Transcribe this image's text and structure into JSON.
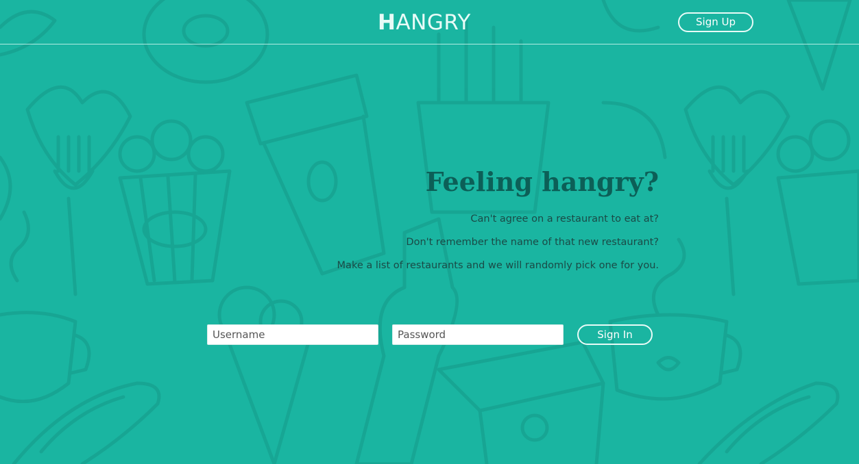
{
  "header": {
    "logo_first": "H",
    "logo_rest": "ANGRY",
    "signup_label": "Sign Up"
  },
  "hero": {
    "title": "Feeling hangry?",
    "lines": [
      "Can't agree on a restaurant to eat at?",
      "Don't remember the name of that new restaurant?",
      "Make a list of restaurants and we will randomly pick one for you."
    ]
  },
  "login": {
    "username_placeholder": "Username",
    "password_placeholder": "Password",
    "signin_label": "Sign In"
  },
  "colors": {
    "background": "#1ab5a1",
    "title": "#0c5f57",
    "text": "#1a4a46",
    "light": "#e8fbf7"
  },
  "background_pattern": {
    "icons": [
      "donut-icon",
      "coffee-cup-icon",
      "fries-icon",
      "pizza-slice-icon",
      "fork-icon",
      "popcorn-icon",
      "soda-bottle-icon",
      "ice-cream-icon",
      "takeout-box-icon",
      "mug-icon",
      "hotdog-icon",
      "heart-icon"
    ]
  }
}
